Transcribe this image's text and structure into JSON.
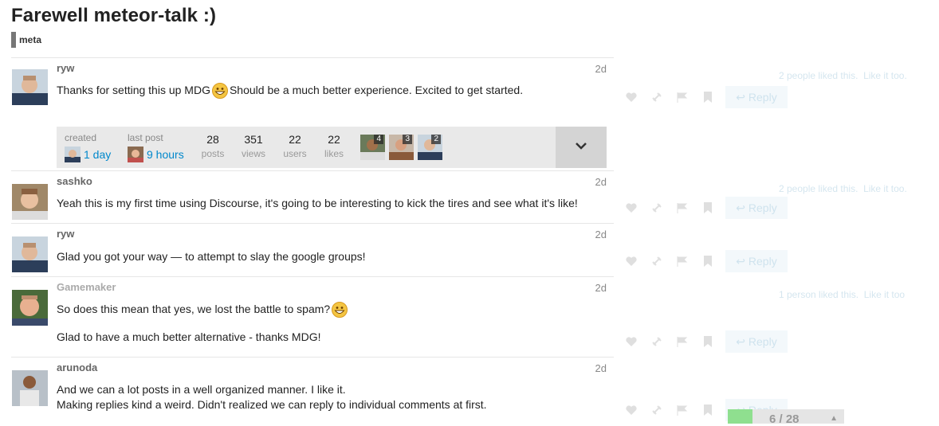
{
  "topic": {
    "title": "Farewell meteor-talk :)",
    "category": "meta"
  },
  "posts": [
    {
      "username": "ryw",
      "date": "2d",
      "lines": [
        "Thanks for setting this up MDG",
        "Should be a much better experience. Excited to get started."
      ],
      "liked_text": "2 people liked this.",
      "like_it_too": "Like it too.",
      "reply": "Reply"
    },
    {
      "username": "sashko",
      "date": "2d",
      "lines": [
        "Yeah this is my first time using Discourse, it's going to be interesting to kick the tires and see what it's like!"
      ],
      "liked_text": "2 people liked this.",
      "like_it_too": "Like it too.",
      "reply": "Reply"
    },
    {
      "username": "ryw",
      "date": "2d",
      "lines": [
        "Glad you got your way — to attempt to slay the google groups!"
      ],
      "reply": "Reply"
    },
    {
      "username": "Gamemaker",
      "date": "2d",
      "lines": [
        "So does this mean that yes, we lost the battle to spam?",
        "Glad to have a much better alternative - thanks MDG!"
      ],
      "liked_text": "1 person liked this.",
      "like_it_too": "Like it too",
      "reply": "Reply"
    },
    {
      "username": "arunoda",
      "date": "2d",
      "lines": [
        "And we can a lot posts in a well organized manner. I like it.",
        "Making replies kind a weird. Didn't realized we can reply to individual comments at first."
      ],
      "reply": "Reply"
    }
  ],
  "summary": {
    "created_label": "created",
    "created_value": "1 day",
    "last_post_label": "last post",
    "last_post_value": "9 hours",
    "stats": [
      {
        "num": "28",
        "label": "posts"
      },
      {
        "num": "351",
        "label": "views"
      },
      {
        "num": "22",
        "label": "users"
      },
      {
        "num": "22",
        "label": "likes"
      }
    ],
    "participants": [
      {
        "count": "4"
      },
      {
        "count": "3"
      },
      {
        "count": "2"
      }
    ]
  },
  "progress": {
    "text": "6 / 28",
    "fraction": 0.214
  },
  "icons": [
    "heart-icon",
    "link-icon",
    "flag-icon",
    "bookmark-icon",
    "reply-icon",
    "chevron-down-icon"
  ],
  "colors": {
    "link": "#0088cc",
    "summary_bg": "#e9e9e9",
    "progress_fill": "#8fdf8f"
  }
}
